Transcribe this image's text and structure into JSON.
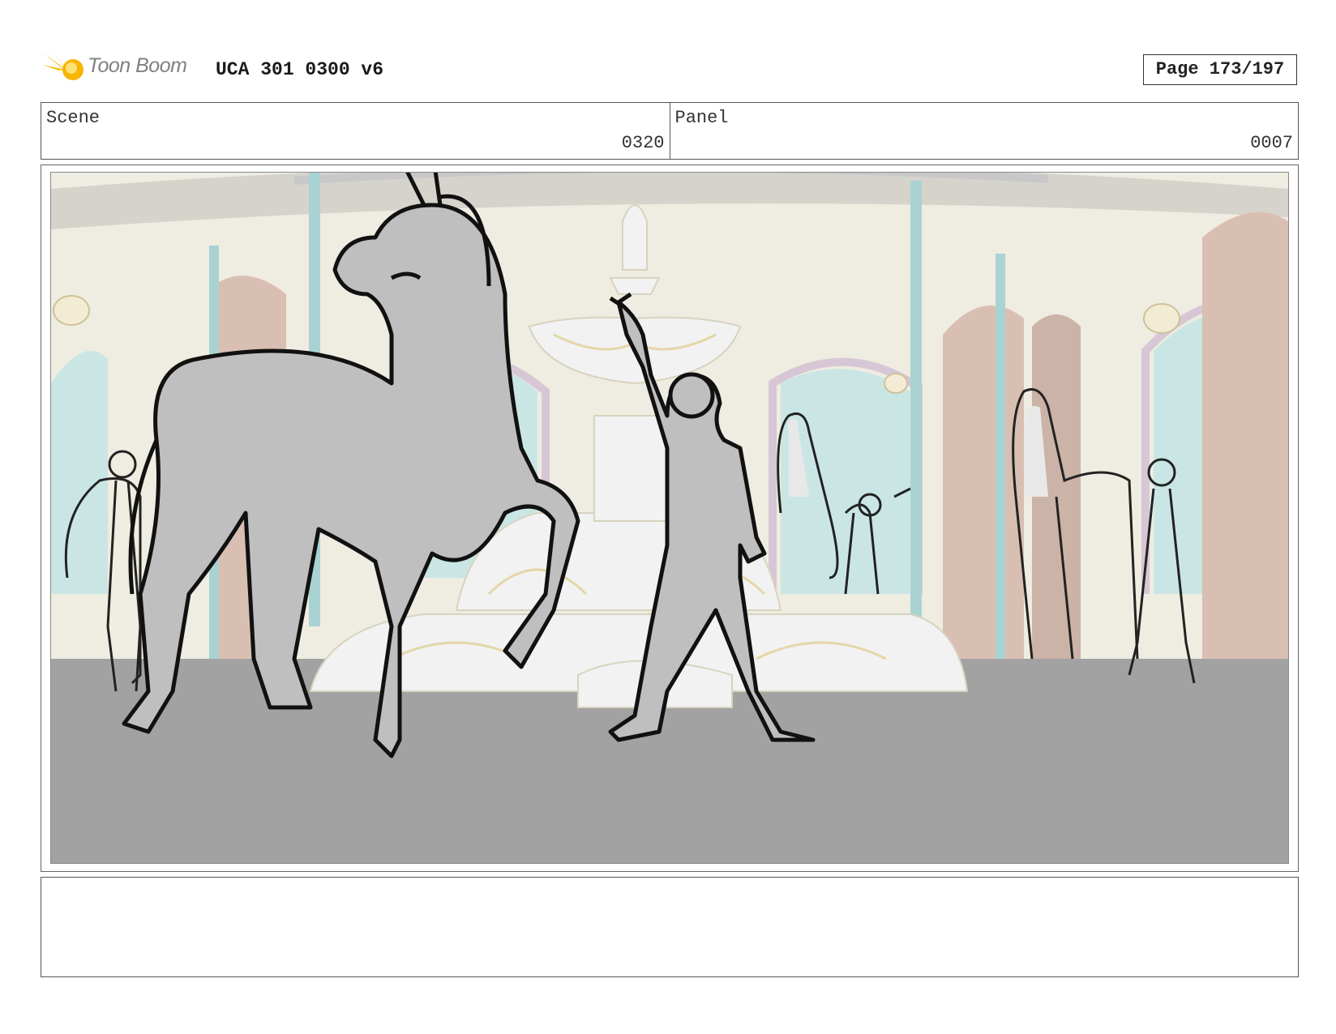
{
  "header": {
    "logo_text": "Toon Boom",
    "doc_title": "UCA 301 0300 v6",
    "page_label": "Page 173/197"
  },
  "info": {
    "scene_label": "Scene",
    "scene_value": "0320",
    "panel_label": "Panel",
    "panel_value": "0007"
  },
  "notes": {
    "text": ""
  },
  "colors": {
    "logo_accent": "#f5c518",
    "logo_text": "#808080",
    "floor": "#a2a2a2",
    "wall": "#efece1",
    "window": "#c9e6e4",
    "door": "#d9bfb2",
    "column": "#a9d3d2"
  }
}
